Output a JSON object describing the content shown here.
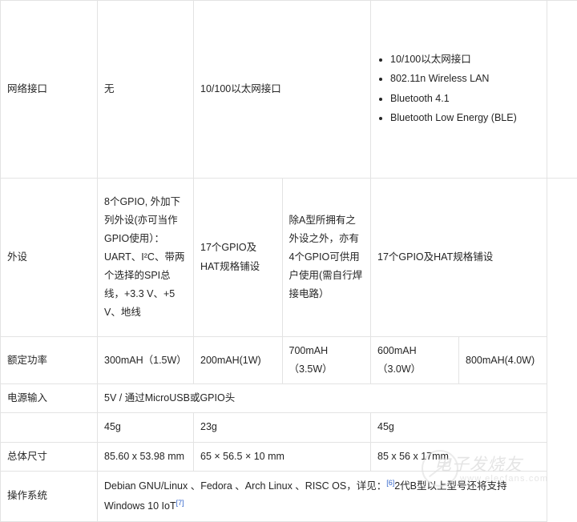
{
  "table": {
    "rows": [
      {
        "label": "网络接口",
        "cells": [
          {
            "text": "无"
          },
          {
            "text": "10/100以太网接口"
          },
          {
            "bullets": [
              "10/100以太网接口",
              "802.11n Wireless LAN",
              "Bluetooth 4.1",
              "Bluetooth Low Energy (BLE)"
            ]
          }
        ]
      },
      {
        "label": "外设",
        "cells": [
          {
            "text": "8个GPIO, 外加下列外设(亦可当作GPIO使用）：UART、I²C、带两个选择的SPI总线，+3.3 V、+5 V、地线"
          },
          {
            "text": "17个GPIO及HAT规格铺设"
          },
          {
            "text": "除A型所拥有之外设之外，亦有4个GPIO可供用户使用(需自行焊接电路）"
          },
          {
            "text": "17个GPIO及HAT规格铺设"
          }
        ]
      },
      {
        "label": "额定功率",
        "cells": [
          {
            "text": "300mAH（1.5W）"
          },
          {
            "text": "200mAH(1W)"
          },
          {
            "text": "700mAH（3.5W）"
          },
          {
            "text": "600mAH（3.0W）"
          },
          {
            "text": "800mAH(4.0W)"
          }
        ]
      },
      {
        "label": "电源输入",
        "cells": [
          {
            "text": "5V / 通过MicroUSB或GPIO头"
          }
        ]
      },
      {
        "label": "",
        "cells": [
          {
            "text": "45g"
          },
          {
            "text": "23g"
          },
          {
            "text": "45g"
          }
        ]
      },
      {
        "label": "总体尺寸",
        "cells": [
          {
            "text": "85.60 x 53.98 mm"
          },
          {
            "text": "65 × 56.5 × 10 mm"
          },
          {
            "text": "85 x 56 x 17mm"
          }
        ]
      },
      {
        "label": "操作系统",
        "os": {
          "part1": "Debian GNU/Linux 、Fedora 、Arch Linux 、RISC OS，详见：",
          "footnote1": "[6]",
          "part2": "2代B型以上型号还将支持Windows 10 IoT",
          "footnote2": "[7]"
        }
      }
    ]
  },
  "watermark": {
    "brand": "电子发烧友",
    "url": "www.elecfans.com"
  },
  "colors": {
    "text": "#252525",
    "border": "#e3e3e3",
    "link": "#3366cc",
    "background": "#ffffff"
  }
}
